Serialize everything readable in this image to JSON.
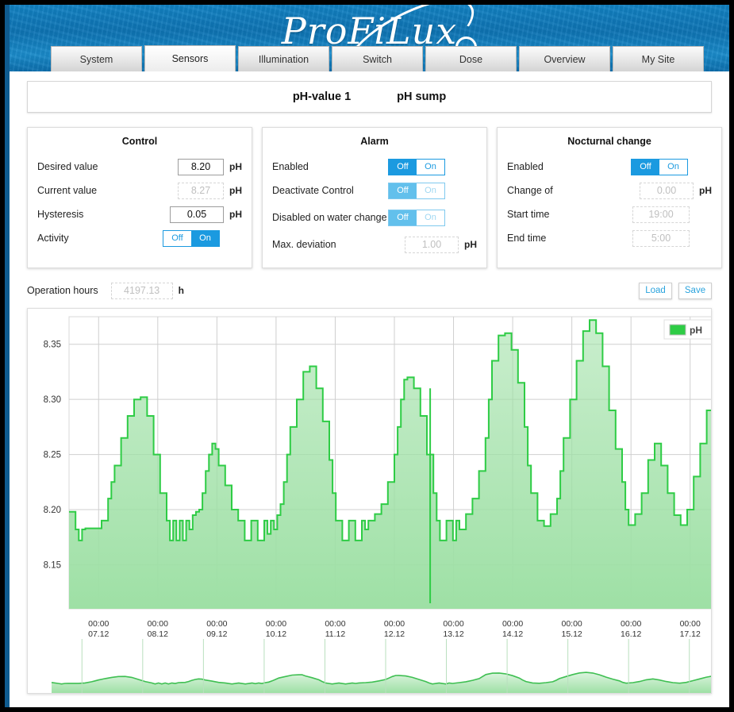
{
  "brand": {
    "name": "ProFiLux"
  },
  "tabs": [
    {
      "label": "System",
      "active": false
    },
    {
      "label": "Sensors",
      "active": true
    },
    {
      "label": "Illumination",
      "active": false
    },
    {
      "label": "Switch",
      "active": false
    },
    {
      "label": "Dose",
      "active": false
    },
    {
      "label": "Overview",
      "active": false
    },
    {
      "label": "My Site",
      "active": false
    }
  ],
  "title": {
    "sensor": "pH-value 1",
    "location": "pH sump"
  },
  "control": {
    "heading": "Control",
    "desired_label": "Desired value",
    "desired_value": "8.20",
    "desired_unit": "pH",
    "current_label": "Current value",
    "current_value": "8.27",
    "current_unit": "pH",
    "hysteresis_label": "Hysteresis",
    "hysteresis_value": "0.05",
    "hysteresis_unit": "pH",
    "activity_label": "Activity",
    "activity_off": "Off",
    "activity_on": "On",
    "activity_state": "On"
  },
  "alarm": {
    "heading": "Alarm",
    "enabled_label": "Enabled",
    "enabled_off": "Off",
    "enabled_on": "On",
    "enabled_state": "Off",
    "deactivate_label": "Deactivate Control",
    "deactivate_off": "Off",
    "deactivate_on": "On",
    "deactivate_state": "Off",
    "waterchange_label": "Disabled on water change",
    "waterchange_off": "Off",
    "waterchange_on": "On",
    "waterchange_state": "Off",
    "maxdev_label": "Max. deviation",
    "maxdev_value": "1.00",
    "maxdev_unit": "pH"
  },
  "nocturnal": {
    "heading": "Nocturnal change",
    "enabled_label": "Enabled",
    "enabled_off": "Off",
    "enabled_on": "On",
    "enabled_state": "Off",
    "change_label": "Change of",
    "change_value": "0.00",
    "change_unit": "pH",
    "start_label": "Start time",
    "start_value": "19:00",
    "end_label": "End time",
    "end_value": "5:00"
  },
  "operation": {
    "label": "Operation hours",
    "value": "4197.13",
    "unit": "h",
    "load_label": "Load",
    "save_label": "Save"
  },
  "chart_data": {
    "type": "area",
    "title": "",
    "xlabel": "",
    "ylabel": "",
    "series_name": "pH",
    "legend": [
      "pH"
    ],
    "legend_position": "top-right",
    "grid": true,
    "color": "#2ecc45",
    "fill_color": "#9ee0a5",
    "ylim": [
      8.11,
      8.375
    ],
    "yticks": [
      8.15,
      8.2,
      8.25,
      8.3,
      8.35
    ],
    "ytick_labels": [
      "8.15",
      "8.20",
      "8.25",
      "8.30",
      "8.35"
    ],
    "xticks": [
      {
        "time": "00:00",
        "date": "07.12"
      },
      {
        "time": "00:00",
        "date": "08.12"
      },
      {
        "time": "00:00",
        "date": "09.12"
      },
      {
        "time": "00:00",
        "date": "10.12"
      },
      {
        "time": "00:00",
        "date": "11.12"
      },
      {
        "time": "00:00",
        "date": "12.12"
      },
      {
        "time": "00:00",
        "date": "13.12"
      },
      {
        "time": "00:00",
        "date": "14.12"
      },
      {
        "time": "00:00",
        "date": "15.12"
      },
      {
        "time": "00:00",
        "date": "16.12"
      },
      {
        "time": "00:00",
        "date": "17.12"
      }
    ],
    "x_start": "06.12 12:00",
    "x_end": "17.12 12:00",
    "x": [
      0.0,
      0.01,
      0.015,
      0.02,
      0.025,
      0.03,
      0.04,
      0.05,
      0.06,
      0.065,
      0.07,
      0.08,
      0.09,
      0.1,
      0.11,
      0.12,
      0.13,
      0.14,
      0.15,
      0.155,
      0.16,
      0.165,
      0.17,
      0.175,
      0.18,
      0.185,
      0.19,
      0.195,
      0.2,
      0.205,
      0.21,
      0.215,
      0.22,
      0.225,
      0.23,
      0.24,
      0.25,
      0.26,
      0.27,
      0.28,
      0.29,
      0.3,
      0.305,
      0.31,
      0.315,
      0.32,
      0.325,
      0.33,
      0.335,
      0.34,
      0.35,
      0.36,
      0.37,
      0.375,
      0.38,
      0.39,
      0.4,
      0.405,
      0.41,
      0.42,
      0.43,
      0.44,
      0.45,
      0.455,
      0.46,
      0.47,
      0.48,
      0.49,
      0.5,
      0.505,
      0.51,
      0.515,
      0.52,
      0.53,
      0.54,
      0.55,
      0.56,
      0.565,
      0.57,
      0.58,
      0.59,
      0.595,
      0.6,
      0.61,
      0.62,
      0.63,
      0.64,
      0.645,
      0.65,
      0.66,
      0.67,
      0.68,
      0.69,
      0.7,
      0.705,
      0.71,
      0.72,
      0.73,
      0.74,
      0.75,
      0.755,
      0.76,
      0.77,
      0.78,
      0.79,
      0.8,
      0.81,
      0.82,
      0.83,
      0.84,
      0.85,
      0.855,
      0.86,
      0.87,
      0.88,
      0.89,
      0.9,
      0.91,
      0.92,
      0.93,
      0.94,
      0.95,
      0.96,
      0.97,
      0.98,
      0.99,
      1.0
    ],
    "y": [
      8.198,
      8.182,
      8.172,
      8.182,
      8.183,
      8.183,
      8.183,
      8.19,
      8.21,
      8.225,
      8.24,
      8.265,
      8.285,
      8.3,
      8.302,
      8.285,
      8.25,
      8.215,
      8.19,
      8.172,
      8.19,
      8.172,
      8.19,
      8.172,
      8.19,
      8.182,
      8.195,
      8.198,
      8.2,
      8.215,
      8.235,
      8.25,
      8.26,
      8.255,
      8.24,
      8.222,
      8.2,
      8.19,
      8.172,
      8.19,
      8.172,
      8.19,
      8.178,
      8.19,
      8.182,
      8.195,
      8.205,
      8.225,
      8.25,
      8.275,
      8.3,
      8.325,
      8.33,
      8.33,
      8.31,
      8.28,
      8.245,
      8.215,
      8.19,
      8.172,
      8.19,
      8.172,
      8.19,
      8.182,
      8.19,
      8.196,
      8.205,
      8.225,
      8.25,
      8.275,
      8.3,
      8.318,
      8.32,
      8.31,
      8.285,
      8.25,
      8.215,
      8.19,
      8.172,
      8.19,
      8.172,
      8.19,
      8.182,
      8.196,
      8.21,
      8.235,
      8.265,
      8.3,
      8.335,
      8.358,
      8.36,
      8.345,
      8.315,
      8.275,
      8.24,
      8.215,
      8.19,
      8.185,
      8.196,
      8.21,
      8.235,
      8.265,
      8.3,
      8.335,
      8.362,
      8.372,
      8.36,
      8.33,
      8.29,
      8.255,
      8.225,
      8.2,
      8.186,
      8.196,
      8.215,
      8.245,
      8.26,
      8.24,
      8.215,
      8.195,
      8.186,
      8.2,
      8.23,
      8.26,
      8.29,
      8.31,
      8.27
    ],
    "annotations": [
      {
        "type": "drop",
        "x": 0.555,
        "y_min": 8.115,
        "y_max": 8.31,
        "note": "sharp water-change dip"
      }
    ],
    "navigator": {
      "visible": true,
      "full_range_selected": true
    }
  }
}
